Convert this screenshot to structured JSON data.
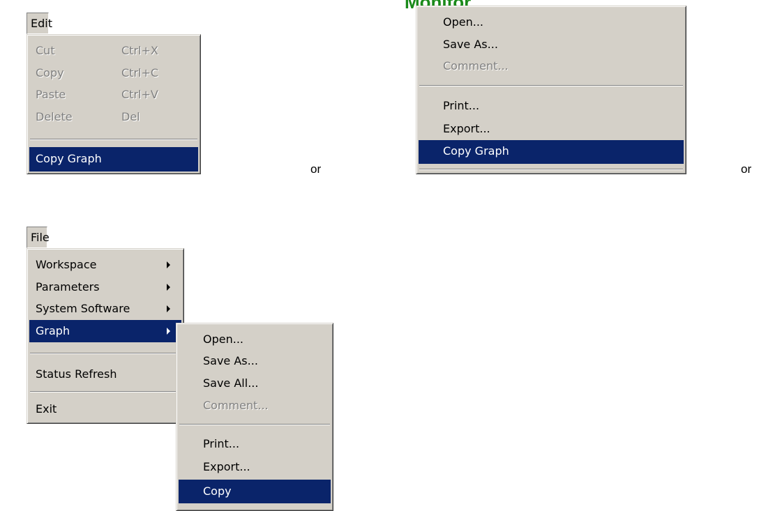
{
  "edit_menu": {
    "title": "Edit",
    "items": [
      {
        "label": "Cut",
        "shortcut": "Ctrl+X",
        "enabled": false
      },
      {
        "label": "Copy",
        "shortcut": "Ctrl+C",
        "enabled": false
      },
      {
        "label": "Paste",
        "shortcut": "Ctrl+V",
        "enabled": false
      },
      {
        "label": "Delete",
        "shortcut": "Del",
        "enabled": false
      }
    ],
    "copy_graph": "Copy Graph"
  },
  "or_labels": [
    "or",
    "or"
  ],
  "graph_context_menu": {
    "header_partial": "Monitor",
    "items": [
      {
        "label": "Open...",
        "enabled": true
      },
      {
        "label": "Save As...",
        "enabled": true
      },
      {
        "label": "Comment...",
        "enabled": false
      },
      {
        "label": "Print...",
        "enabled": true
      },
      {
        "label": "Export...",
        "enabled": true
      },
      {
        "label": "Copy Graph",
        "enabled": true,
        "selected": true
      }
    ]
  },
  "file_menu": {
    "title": "File",
    "items": [
      {
        "label": "Workspace",
        "submenu": true
      },
      {
        "label": "Parameters",
        "submenu": true
      },
      {
        "label": "System Software",
        "submenu": true
      },
      {
        "label": "Graph",
        "submenu": true,
        "selected": true
      },
      {
        "label": "Status Refresh"
      },
      {
        "label": "Exit"
      }
    ]
  },
  "graph_submenu": {
    "items": [
      {
        "label": "Open...",
        "enabled": true
      },
      {
        "label": "Save As...",
        "enabled": true
      },
      {
        "label": "Save All...",
        "enabled": true
      },
      {
        "label": "Comment...",
        "enabled": false
      },
      {
        "label": "Print...",
        "enabled": true
      },
      {
        "label": "Export...",
        "enabled": true
      },
      {
        "label": "Copy",
        "enabled": true,
        "selected": true
      }
    ]
  },
  "colors": {
    "menu_bg": "#d4d0c8",
    "selection": "#0a246a",
    "disabled_text": "#808080",
    "monitor_green": "#1a8a1a"
  }
}
